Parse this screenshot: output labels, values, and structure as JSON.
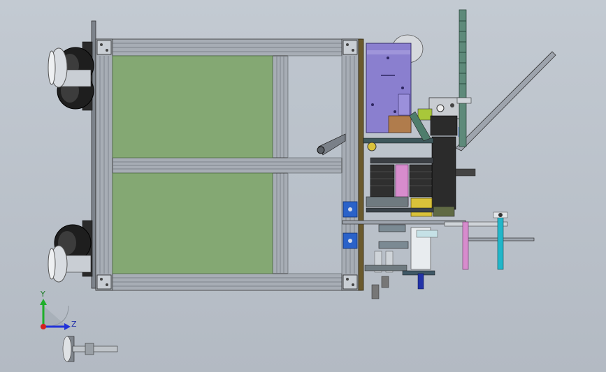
{
  "viewport": {
    "background_top": "#c3cad2",
    "background_bottom": "#b3bac3"
  },
  "triad": {
    "y_label": "Y",
    "z_label": "Z",
    "y_color": "#1fae2a",
    "z_color": "#2233d8",
    "origin_color": "#d42020"
  },
  "colors": {
    "frame_aluminium": "#9ea4ad",
    "panel_green": "#84a873",
    "motor_mount_purple": "#8a7fcf",
    "motor_black": "#2b2b2b",
    "accent_blue": "#2a62c9",
    "accent_cyan": "#22b6c9",
    "accent_pink": "#d78ccd",
    "accent_yellow": "#d9c23a",
    "plate_brown": "#6b5a2d"
  },
  "parts": [
    "aluminium-frame",
    "green-panel",
    "caster-wheel",
    "leveling-foot",
    "motor-mount-plate",
    "stepper-motor",
    "guide-rail",
    "threaded-rod",
    "mounting-bracket"
  ]
}
